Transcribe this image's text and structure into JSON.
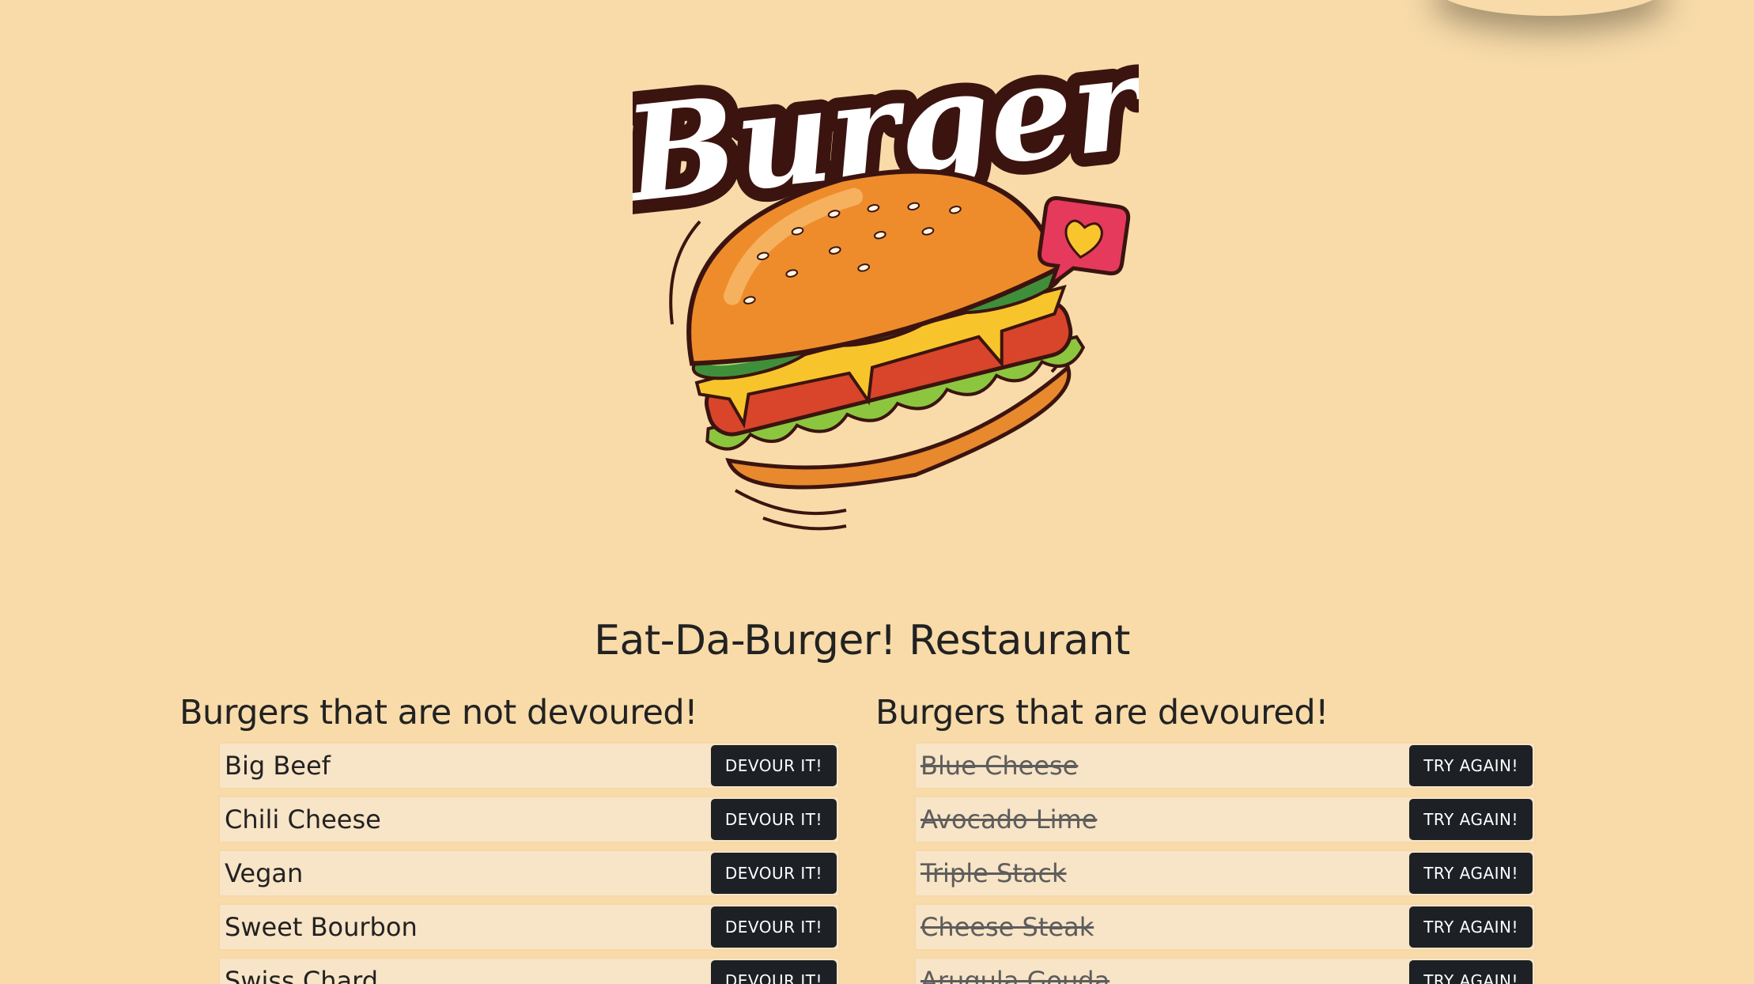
{
  "header": {
    "logo_text": "Burger",
    "title": "Eat-Da-Burger! Restaurant"
  },
  "not_devoured": {
    "heading": "Burgers that are not devoured!",
    "button_label": "DEVOUR IT!",
    "items": [
      {
        "name": "Big Beef"
      },
      {
        "name": "Chili Cheese"
      },
      {
        "name": "Vegan"
      },
      {
        "name": "Sweet Bourbon"
      },
      {
        "name": "Swiss Chard"
      }
    ]
  },
  "devoured": {
    "heading": "Burgers that are devoured!",
    "button_label": "TRY AGAIN!",
    "items": [
      {
        "name": "Blue Cheese"
      },
      {
        "name": "Avocado Lime"
      },
      {
        "name": "Triple Stack"
      },
      {
        "name": "Cheese Steak"
      },
      {
        "name": "Arugula Gouda"
      }
    ]
  },
  "colors": {
    "background": "#f8dba9",
    "button": "#1d2125",
    "row": "#f8e4c6"
  }
}
